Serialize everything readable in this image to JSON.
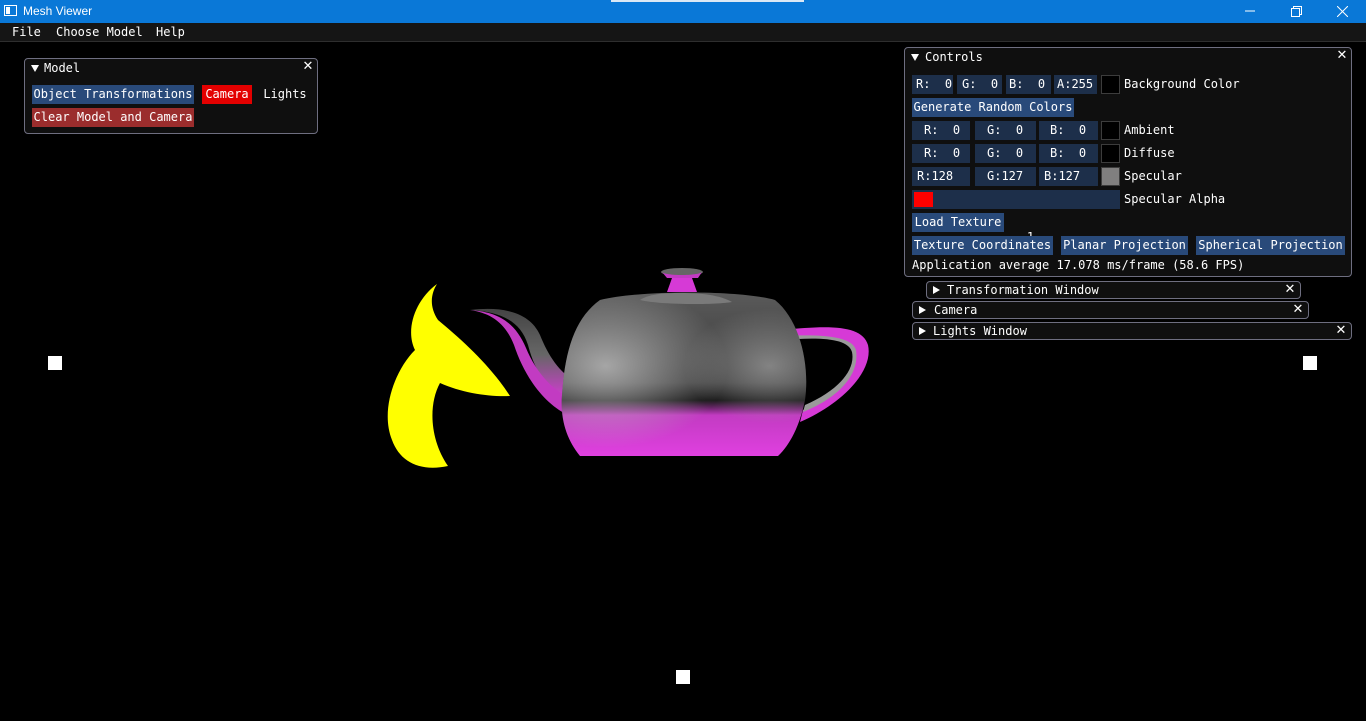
{
  "window": {
    "title": "Mesh Viewer"
  },
  "menu": [
    "File",
    "Choose Model",
    "Help"
  ],
  "model_panel": {
    "title": "Model",
    "buttons": [
      "Object Transformations",
      "Camera",
      "Lights",
      "Clear Model and Camera"
    ]
  },
  "controls_panel": {
    "title": "Controls",
    "background": {
      "r": "R:  0",
      "g": "G:  0",
      "b": "B:  0",
      "a": "A:255",
      "label": "Background Color",
      "swatch": "#000000"
    },
    "random_button": "Generate Random Colors",
    "ambient": {
      "r": "R:  0",
      "g": "G:  0",
      "b": "B:  0",
      "label": "Ambient",
      "swatch": "#000000"
    },
    "diffuse": {
      "r": "R:  0",
      "g": "G:  0",
      "b": "B:  0",
      "label": "Diffuse",
      "swatch": "#000000"
    },
    "specular": {
      "r": "R:128",
      "g": "G:127",
      "b": "B:127",
      "label": "Specular",
      "swatch": "#807f7f"
    },
    "specular_alpha": {
      "value": "1",
      "label": "Specular Alpha"
    },
    "load_texture": "Load Texture",
    "projection_buttons": [
      "Texture Coordinates",
      "Planar Projection",
      "Spherical Projection"
    ],
    "fps_text": "Application average 17.078 ms/frame (58.6 FPS)"
  },
  "collapsed_windows": [
    "Transformation Window",
    "Camera",
    "Lights Window"
  ],
  "colors": {
    "titlebar": "#0a78d7",
    "button": "#294a7a",
    "active_button": "#e30000",
    "teapot_rim": "#d63ad6",
    "light_shape": "#ffff00"
  }
}
